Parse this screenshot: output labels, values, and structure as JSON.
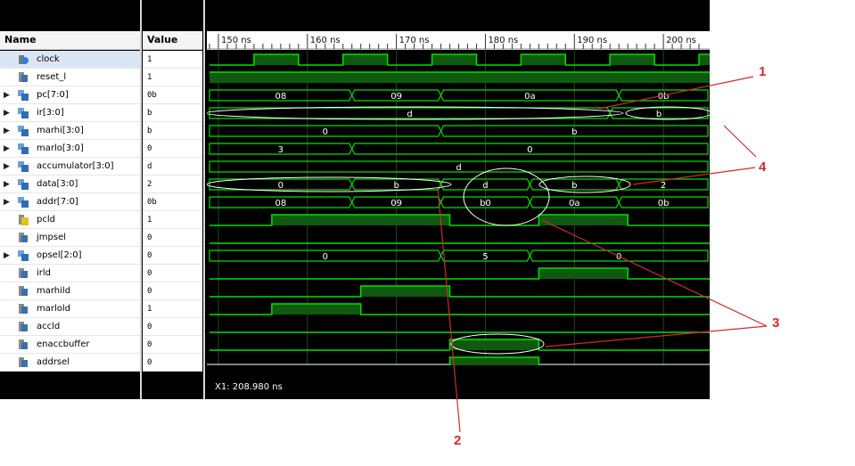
{
  "headers": {
    "name": "Name",
    "value": "Value"
  },
  "time_axis": {
    "ticks": [
      "150 ns",
      "160 ns",
      "170 ns",
      "180 ns",
      "190 ns",
      "200 ns"
    ],
    "start_ns": 149.0,
    "end_ns": 204.9
  },
  "cursor": {
    "label": "X1: 208.980 ns"
  },
  "signals": [
    {
      "name": "clock",
      "value": "1",
      "kind": "bit",
      "icon": "clock-icon",
      "expandable": false,
      "selected": true,
      "wave": [
        [
          149,
          0.0,
          "H"
        ],
        [
          154,
          1
        ],
        [
          159,
          0
        ],
        [
          164,
          1
        ],
        [
          169,
          0
        ],
        [
          174,
          1
        ],
        [
          179,
          0
        ],
        [
          184,
          1
        ],
        [
          189,
          0
        ],
        [
          194,
          1
        ],
        [
          199,
          0
        ],
        [
          204,
          1
        ]
      ]
    },
    {
      "name": "reset_l",
      "value": "1",
      "kind": "bit",
      "icon": "bit-icon",
      "expandable": false,
      "wave": [
        [
          149,
          1
        ]
      ]
    },
    {
      "name": "pc[7:0]",
      "value": "0b",
      "kind": "bus",
      "icon": "bus-icon",
      "expandable": true,
      "segments": [
        [
          "08",
          149,
          165
        ],
        [
          "09",
          165,
          175
        ],
        [
          "0a",
          175,
          195
        ],
        [
          "0b",
          195,
          205
        ]
      ]
    },
    {
      "name": "ir[3:0]",
      "value": "b",
      "kind": "bus",
      "icon": "bus-icon",
      "expandable": true,
      "segments": [
        [
          "d",
          149,
          194
        ],
        [
          "b",
          194,
          205
        ]
      ]
    },
    {
      "name": "marhi[3:0]",
      "value": "b",
      "kind": "bus",
      "icon": "bus-icon",
      "expandable": true,
      "segments": [
        [
          "0",
          149,
          175
        ],
        [
          "b",
          175,
          205
        ]
      ]
    },
    {
      "name": "marlo[3:0]",
      "value": "0",
      "kind": "bus",
      "icon": "bus-icon",
      "expandable": true,
      "segments": [
        [
          "3",
          149,
          165
        ],
        [
          "0",
          165,
          205
        ]
      ]
    },
    {
      "name": "accumulator[3:0]",
      "value": "d",
      "kind": "bus",
      "icon": "bus-icon",
      "expandable": true,
      "segments": [
        [
          "d",
          149,
          205
        ]
      ]
    },
    {
      "name": "data[3:0]",
      "value": "2",
      "kind": "bus",
      "icon": "bus-icon",
      "expandable": true,
      "segments": [
        [
          "0",
          149,
          165
        ],
        [
          "b",
          165,
          175
        ],
        [
          "d",
          175,
          185
        ],
        [
          "b",
          185,
          195
        ],
        [
          "2",
          195,
          205
        ]
      ]
    },
    {
      "name": "addr[7:0]",
      "value": "0b",
      "kind": "bus",
      "icon": "bus-icon",
      "expandable": true,
      "segments": [
        [
          "08",
          149,
          165
        ],
        [
          "09",
          165,
          175
        ],
        [
          "b0",
          175,
          185
        ],
        [
          "0a",
          185,
          195
        ],
        [
          "0b",
          195,
          205
        ]
      ]
    },
    {
      "name": "pcld",
      "value": "1",
      "kind": "bit",
      "icon": "bit-yellow-icon",
      "expandable": false,
      "wave": [
        [
          149,
          0
        ],
        [
          156,
          1
        ],
        [
          176,
          0
        ],
        [
          186,
          1
        ],
        [
          196,
          0
        ]
      ]
    },
    {
      "name": "jmpsel",
      "value": "0",
      "kind": "bit",
      "icon": "bit-icon",
      "expandable": false,
      "wave": [
        [
          149,
          0
        ]
      ]
    },
    {
      "name": "opsel[2:0]",
      "value": "0",
      "kind": "bus",
      "icon": "bus-icon",
      "expandable": true,
      "segments": [
        [
          "0",
          149,
          175
        ],
        [
          "5",
          175,
          185
        ],
        [
          "0",
          185,
          205
        ]
      ]
    },
    {
      "name": "irld",
      "value": "0",
      "kind": "bit",
      "icon": "bit-icon",
      "expandable": false,
      "wave": [
        [
          149,
          0
        ],
        [
          186,
          1
        ],
        [
          196,
          0
        ]
      ]
    },
    {
      "name": "marhild",
      "value": "0",
      "kind": "bit",
      "icon": "bit-icon",
      "expandable": false,
      "wave": [
        [
          149,
          0
        ],
        [
          166,
          1
        ],
        [
          176,
          0
        ]
      ]
    },
    {
      "name": "marlold",
      "value": "1",
      "kind": "bit",
      "icon": "bit-icon",
      "expandable": false,
      "wave": [
        [
          149,
          0
        ],
        [
          156,
          1
        ],
        [
          166,
          0
        ]
      ]
    },
    {
      "name": "accld",
      "value": "0",
      "kind": "bit",
      "icon": "bit-icon",
      "expandable": false,
      "wave": [
        [
          149,
          0
        ]
      ]
    },
    {
      "name": "enaccbuffer",
      "value": "0",
      "kind": "bit",
      "icon": "bit-icon",
      "expandable": false,
      "wave": [
        [
          149,
          0
        ],
        [
          176,
          1
        ],
        [
          186,
          0
        ]
      ]
    },
    {
      "name": "addrsel",
      "value": "0",
      "kind": "bit",
      "icon": "bit-icon",
      "expandable": false,
      "wave": [
        [
          149,
          0
        ],
        [
          176,
          1
        ],
        [
          186,
          0
        ]
      ]
    }
  ],
  "annotations": [
    "1",
    "2",
    "3",
    "4"
  ],
  "colors": {
    "wave": "#00e000",
    "fill": "#0f5a0f",
    "highlight": "#ffffff",
    "annotation": "#d42a2a"
  }
}
